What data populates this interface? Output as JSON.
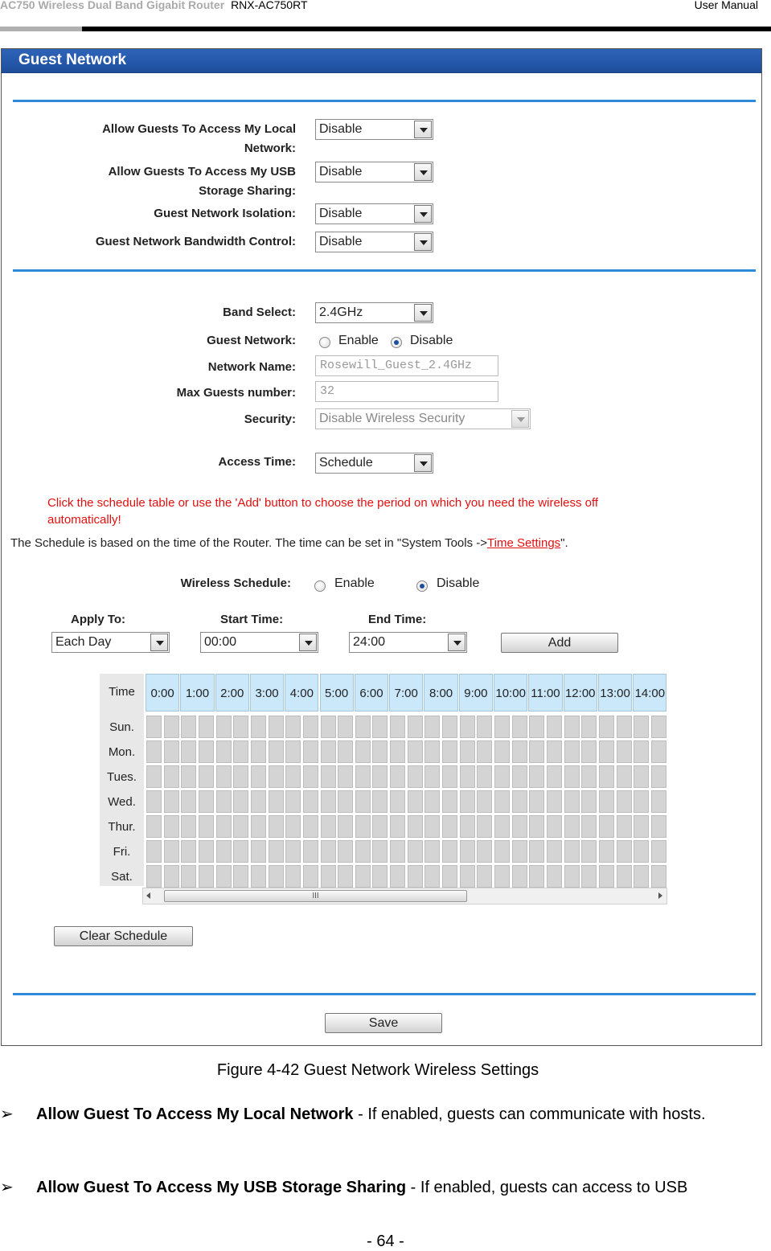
{
  "header": {
    "product": "AC750  Wireless  Dual  Band  Gigabit  Router",
    "model": "RNX-AC750RT",
    "doc_type": "User  Manual"
  },
  "screenshot": {
    "title": "Guest Network",
    "fields": {
      "allow_local_label": "Allow Guests To Access My Local Network:",
      "allow_local_value": "Disable",
      "allow_usb_label": "Allow Guests To Access My USB Storage Sharing:",
      "allow_usb_value": "Disable",
      "isolation_label": "Guest Network Isolation:",
      "isolation_value": "Disable",
      "bandwidth_label": "Guest Network Bandwidth Control:",
      "bandwidth_value": "Disable",
      "band_label": "Band Select:",
      "band_value": "2.4GHz",
      "guest_network_label": "Guest Network:",
      "guest_network_enable": "Enable",
      "guest_network_disable": "Disable",
      "network_name_label": "Network Name:",
      "network_name_value": "Rosewill_Guest_2.4GHz",
      "max_guests_label": "Max Guests number:",
      "max_guests_value": "32",
      "security_label": "Security:",
      "security_value": "Disable Wireless Security",
      "access_time_label": "Access Time:",
      "access_time_value": "Schedule"
    },
    "notice_red": "Click the schedule table or use the 'Add' button to choose the period on which you need the wireless off automatically!",
    "info_prefix": "The Schedule is based on the time of the Router. The time can be set in \"System Tools ->",
    "info_link": "Time Settings",
    "info_suffix": "\".",
    "wireless_schedule_label": "Wireless Schedule:",
    "wireless_schedule_enable": "Enable",
    "wireless_schedule_disable": "Disable",
    "apply_to_label": "Apply To:",
    "apply_to_value": "Each Day",
    "start_time_label": "Start Time:",
    "start_time_value": "00:00",
    "end_time_label": "End Time:",
    "end_time_value": "24:00",
    "add_button": "Add",
    "schedule": {
      "corner": "Time",
      "hours": [
        "0:00",
        "1:00",
        "2:00",
        "3:00",
        "4:00",
        "5:00",
        "6:00",
        "7:00",
        "8:00",
        "9:00",
        "10:00",
        "11:00",
        "12:00",
        "13:00",
        "14:00"
      ],
      "days": [
        "Sun.",
        "Mon.",
        "Tues.",
        "Wed.",
        "Thur.",
        "Fri.",
        "Sat."
      ]
    },
    "scroll_grip": "III",
    "clear_button": "Clear Schedule",
    "save_button": "Save"
  },
  "caption": "Figure 4-42 Guest Network Wireless Settings",
  "bullets": [
    {
      "term": "Allow  Guest  To  Access  My  Local  Network",
      "text": " -  If  enabled,  guests  can  communicate  with hosts."
    },
    {
      "term": "Allow Guest To Access My USB Storage Sharing",
      "text": " - If enabled, guests can access to USB"
    }
  ],
  "bullet_symbol": "➢",
  "page_number": "- 64 -"
}
